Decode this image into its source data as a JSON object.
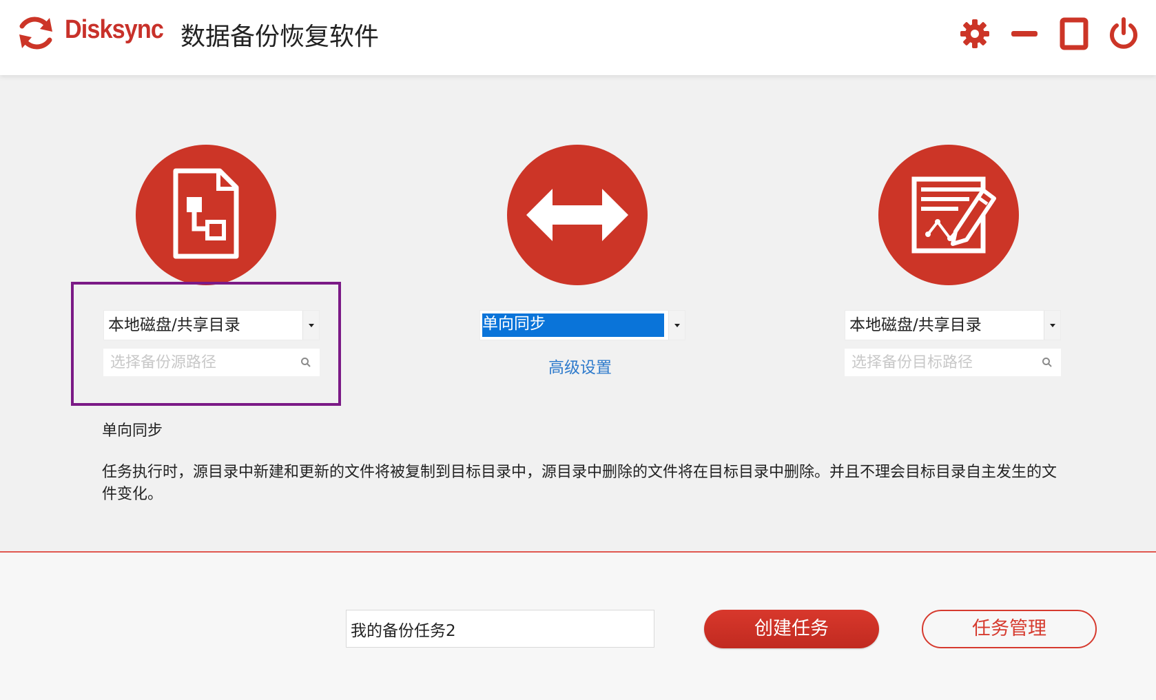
{
  "header": {
    "brand": "Disksync",
    "title": "数据备份恢复软件",
    "controls": [
      "gear-icon",
      "minimize-icon",
      "maximize-icon",
      "power-icon"
    ]
  },
  "source": {
    "type_selected": "本地磁盘/共享目录",
    "path_placeholder": "选择备份源路径"
  },
  "sync": {
    "mode_selected": "单向同步",
    "advanced_link": "高级设置"
  },
  "target": {
    "type_selected": "本地磁盘/共享目录",
    "path_placeholder": "选择备份目标路径"
  },
  "description": {
    "title": "单向同步",
    "text": "任务执行时，源目录中新建和更新的文件将被复制到目标目录中，源目录中删除的文件将在目标目录中删除。并且不理会目标目录自主发生的文件变化。"
  },
  "footer": {
    "task_name_value": "我的备份任务2",
    "create_button": "创建任务",
    "manage_button": "任务管理"
  },
  "colors": {
    "accent": "#cc3527",
    "highlight": "#0a74d9",
    "link": "#2f7bcc",
    "focus_border": "#7b1a86"
  }
}
